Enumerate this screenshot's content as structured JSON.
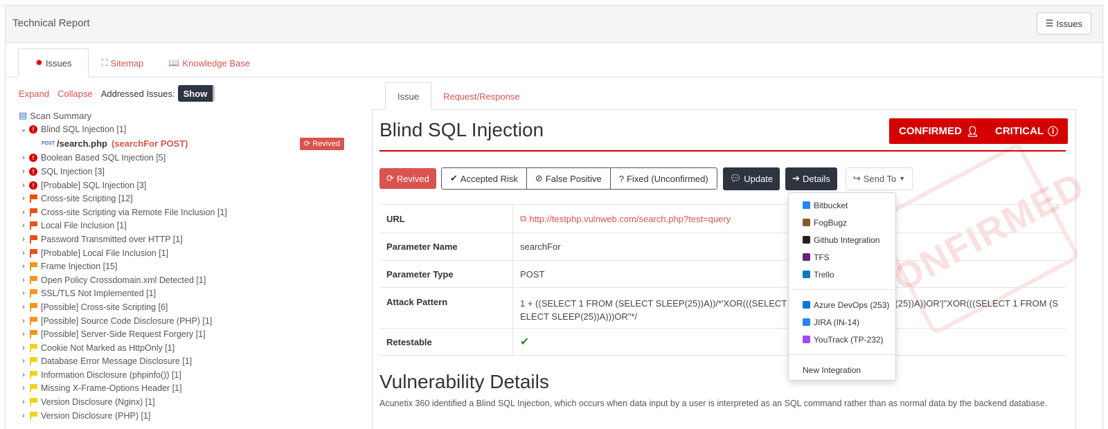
{
  "header": {
    "title": "Technical Report",
    "issues_button": "Issues"
  },
  "main_tabs": [
    {
      "label": "Issues",
      "icon": "bug-icon"
    },
    {
      "label": "Sitemap",
      "icon": "sitemap-icon"
    },
    {
      "label": "Knowledge Base",
      "icon": "book-icon"
    }
  ],
  "toolbar": {
    "expand": "Expand",
    "collapse": "Collapse",
    "addressed_label": "Addressed Issues:",
    "show": "Show"
  },
  "tree": {
    "summary": "Scan Summary",
    "expanded_item": "Blind SQL Injection [1]",
    "child": {
      "method": "POST",
      "path": "/search.php",
      "param": "(searchFor POST)",
      "status": "Revived"
    },
    "items": [
      {
        "label": "Boolean Based SQL Injection [5]",
        "severity": "critical"
      },
      {
        "label": "SQL Injection [3]",
        "severity": "critical"
      },
      {
        "label": "[Probable] SQL Injection [3]",
        "severity": "critical"
      },
      {
        "label": "Cross-site Scripting [12]",
        "severity": "high"
      },
      {
        "label": "Cross-site Scripting via Remote File Inclusion [1]",
        "severity": "high"
      },
      {
        "label": "Local File Inclusion [1]",
        "severity": "high"
      },
      {
        "label": "Password Transmitted over HTTP [1]",
        "severity": "high"
      },
      {
        "label": "[Probable] Local File Inclusion [1]",
        "severity": "high"
      },
      {
        "label": "Frame Injection [15]",
        "severity": "medium"
      },
      {
        "label": "Open Policy Crossdomain.xml Detected [1]",
        "severity": "medium"
      },
      {
        "label": "SSL/TLS Not Implemented [1]",
        "severity": "medium"
      },
      {
        "label": "[Possible] Cross-site Scripting [6]",
        "severity": "medium"
      },
      {
        "label": "[Possible] Source Code Disclosure (PHP) [1]",
        "severity": "medium"
      },
      {
        "label": "[Possible] Server-Side Request Forgery [1]",
        "severity": "medium"
      },
      {
        "label": "Cookie Not Marked as HttpOnly [1]",
        "severity": "low"
      },
      {
        "label": "Database Error Message Disclosure [1]",
        "severity": "low"
      },
      {
        "label": "Information Disclosure (phpinfo()) [1]",
        "severity": "low"
      },
      {
        "label": "Missing X-Frame-Options Header [1]",
        "severity": "low"
      },
      {
        "label": "Version Disclosure (Nginx) [1]",
        "severity": "low"
      },
      {
        "label": "Version Disclosure (PHP) [1]",
        "severity": "low"
      }
    ]
  },
  "sub_tabs": [
    "Issue",
    "Request/Response"
  ],
  "issue": {
    "title": "Blind SQL Injection",
    "confirmed": "CONFIRMED",
    "critical": "CRITICAL",
    "stamp": "CONFIRMED",
    "revived": "Revived",
    "accepted_risk": "Accepted Risk",
    "false_positive": "False Positive",
    "fixed": "Fixed (Unconfirmed)",
    "update": "Update",
    "details": "Details",
    "send_to": "Send To",
    "rows": [
      {
        "key": "URL",
        "value": "http://testphp.vulnweb.com/search.php?test=query"
      },
      {
        "key": "Parameter Name",
        "value": "searchFor"
      },
      {
        "key": "Parameter Type",
        "value": "POST"
      },
      {
        "key": "Attack Pattern",
        "value": "1 + ((SELECT 1 FROM (SELECT SLEEP(25))A))/*'XOR(((SELECT 1 FROM (SELECT SLEEP(25))A))OR'|\"XOR(((SELECT 1 FROM (SELECT SLEEP(25))A)))OR\"*/"
      },
      {
        "key": "Retestable",
        "value": "✔"
      }
    ],
    "details_heading": "Vulnerability Details",
    "details_text": "Acunetix 360 identified a Blind SQL Injection, which occurs when data input by a user is interpreted as an SQL command rather than as normal data by the backend database."
  },
  "send_menu": {
    "group1": [
      {
        "label": "Bitbucket",
        "color": "#2684ff"
      },
      {
        "label": "FogBugz",
        "color": "#8a5a2b"
      },
      {
        "label": "Github Integration",
        "color": "#222222"
      },
      {
        "label": "TFS",
        "color": "#68217a"
      },
      {
        "label": "Trello",
        "color": "#0079bf"
      }
    ],
    "group2": [
      {
        "label": "Azure DevOps (253)",
        "color": "#0078d7"
      },
      {
        "label": "JIRA (IN-14)",
        "color": "#2684ff"
      },
      {
        "label": "YouTrack (TP-232)",
        "color": "#a347f5"
      }
    ],
    "new_integration": "New Integration"
  }
}
